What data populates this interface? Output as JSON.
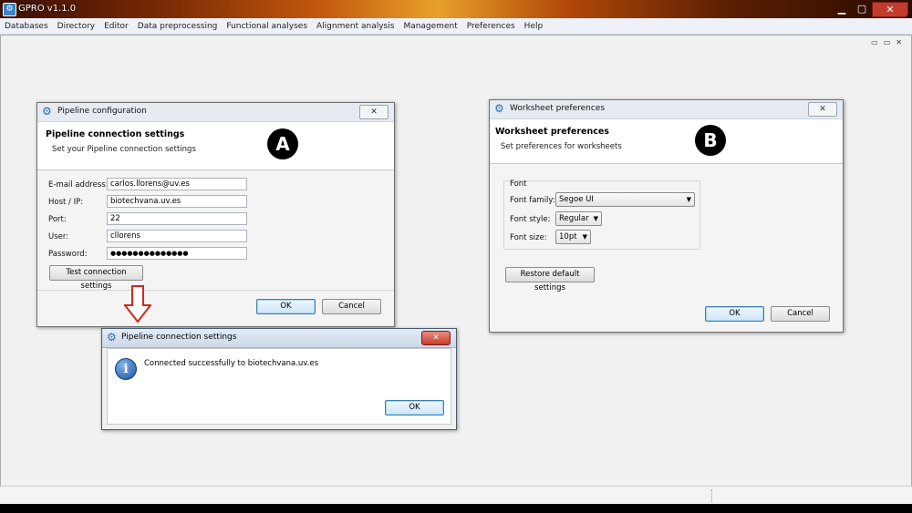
{
  "app": {
    "title": "GPRO v1.1.0"
  },
  "window_controls": {
    "minimize": "▁",
    "maximize": "▢",
    "close": "✕"
  },
  "menu": [
    "Databases",
    "Directory",
    "Editor",
    "Data preprocessing",
    "Functional analyses",
    "Alignment analysis",
    "Management",
    "Preferences",
    "Help"
  ],
  "mdi_controls": {
    "minimize": "▭",
    "maximize": "▭",
    "close": "✕"
  },
  "pipeline_dialog": {
    "title": "Pipeline configuration",
    "header_title": "Pipeline connection settings",
    "header_subtitle": "Set your Pipeline connection settings",
    "badge": "A",
    "fields": [
      {
        "label": "E-mail address:",
        "value": "carlos.llorens@uv.es"
      },
      {
        "label": "Host / IP:",
        "value": "biotechvana.uv.es"
      },
      {
        "label": "Port:",
        "value": "22"
      },
      {
        "label": "User:",
        "value": "cllorens"
      },
      {
        "label": "Password:",
        "value": "●●●●●●●●●●●●●●"
      }
    ],
    "test_button": "Test connection settings",
    "ok": "OK",
    "cancel": "Cancel"
  },
  "message_dialog": {
    "title": "Pipeline connection settings",
    "message": "Connected successfully to biotechvana.uv.es",
    "ok": "OK"
  },
  "worksheet_dialog": {
    "title": "Worksheet preferences",
    "header_title": "Worksheet preferences",
    "header_subtitle": "Set preferences for worksheets",
    "badge": "B",
    "group_label": "Font",
    "font_family_label": "Font family:",
    "font_family_value": "Segoe UI",
    "font_style_label": "Font style:",
    "font_style_value": "Regular",
    "font_size_label": "Font size:",
    "font_size_value": "10pt",
    "restore_button": "Restore default settings",
    "ok": "OK",
    "cancel": "Cancel"
  },
  "colors": {
    "accent_arrow": "#d0271e",
    "dialog_header_bg": "#ffffff",
    "workspace_bg": "#f1f1f1"
  }
}
